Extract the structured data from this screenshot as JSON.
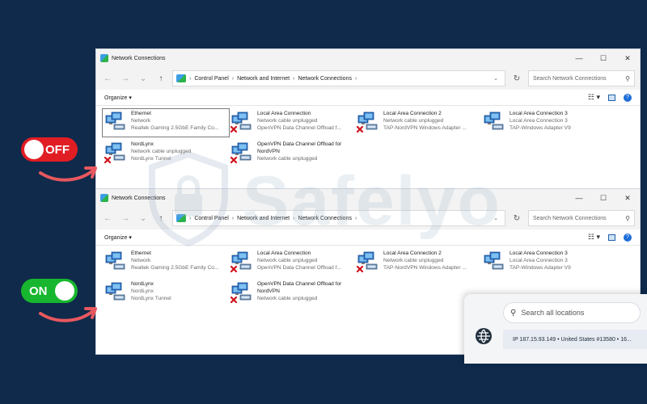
{
  "windows": [
    {
      "title": "Network Connections",
      "breadcrumb": [
        "Control Panel",
        "Network and Internet",
        "Network Connections"
      ],
      "search_placeholder": "Search Network Connections",
      "organize": "Organize",
      "items": [
        {
          "name": "Ethernet",
          "line2": "Network",
          "line3": "Realtek Gaming 2.5GbE Family Co...",
          "disabled": false
        },
        {
          "name": "Local Area Connection",
          "line2": "Network cable unplugged",
          "line3": "OpenVPN Data Channel Offload f...",
          "disabled": true
        },
        {
          "name": "Local Area Connection 2",
          "line2": "Network cable unplugged",
          "line3": "TAP-NordVPN Windows Adapter ...",
          "disabled": true
        },
        {
          "name": "Local Area Connection 3",
          "line2": "Local Area Connection 3",
          "line3": "TAP-Windows Adapter V9",
          "disabled": false
        },
        {
          "name": "NordLynx",
          "line2": "Network cable unplugged",
          "line3": "NordLynx Tunnel",
          "disabled": true
        },
        {
          "name": "OpenVPN Data Channel Offload for NordVPN",
          "line2": "Network cable unplugged",
          "line3": "",
          "disabled": true
        }
      ]
    },
    {
      "title": "Network Connections",
      "breadcrumb": [
        "Control Panel",
        "Network and Internet",
        "Network Connections"
      ],
      "search_placeholder": "Search Network Connections",
      "organize": "Organize",
      "items": [
        {
          "name": "Ethernet",
          "line2": "Network",
          "line3": "Realtek Gaming 2.5GbE Family Co...",
          "disabled": false
        },
        {
          "name": "Local Area Connection",
          "line2": "Network cable unplugged",
          "line3": "OpenVPN Data Channel Offload f...",
          "disabled": true
        },
        {
          "name": "Local Area Connection 2",
          "line2": "Network cable unplugged",
          "line3": "TAP-NordVPN Windows Adapter ...",
          "disabled": true
        },
        {
          "name": "Local Area Connection 3",
          "line2": "Local Area Connection 3",
          "line3": "TAP-Windows Adapter V9",
          "disabled": false
        },
        {
          "name": "NordLynx",
          "line2": "NordLynx",
          "line3": "NordLynx Tunnel",
          "disabled": false
        },
        {
          "name": "OpenVPN Data Channel Offload for NordVPN",
          "line2": "Network cable unplugged",
          "line3": "",
          "disabled": true
        }
      ]
    }
  ],
  "toggles": {
    "off_label": "OFF",
    "on_label": "ON"
  },
  "watermark": "Safelyo",
  "vpn_panel": {
    "search_placeholder": "Search all locations",
    "ip_line": "IP 187.15.93.149 • United States #13580 • 16..."
  },
  "colors": {
    "background": "#0f2a4a",
    "toggle_off": "#e11d24",
    "toggle_on": "#17b62e",
    "arrow": "#e8585f"
  },
  "icons": {
    "window_controls": [
      "minimize-icon",
      "maximize-icon",
      "close-icon"
    ],
    "nav": [
      "back-arrow-icon",
      "forward-arrow-icon",
      "recent-chevron-icon",
      "up-arrow-icon"
    ]
  }
}
